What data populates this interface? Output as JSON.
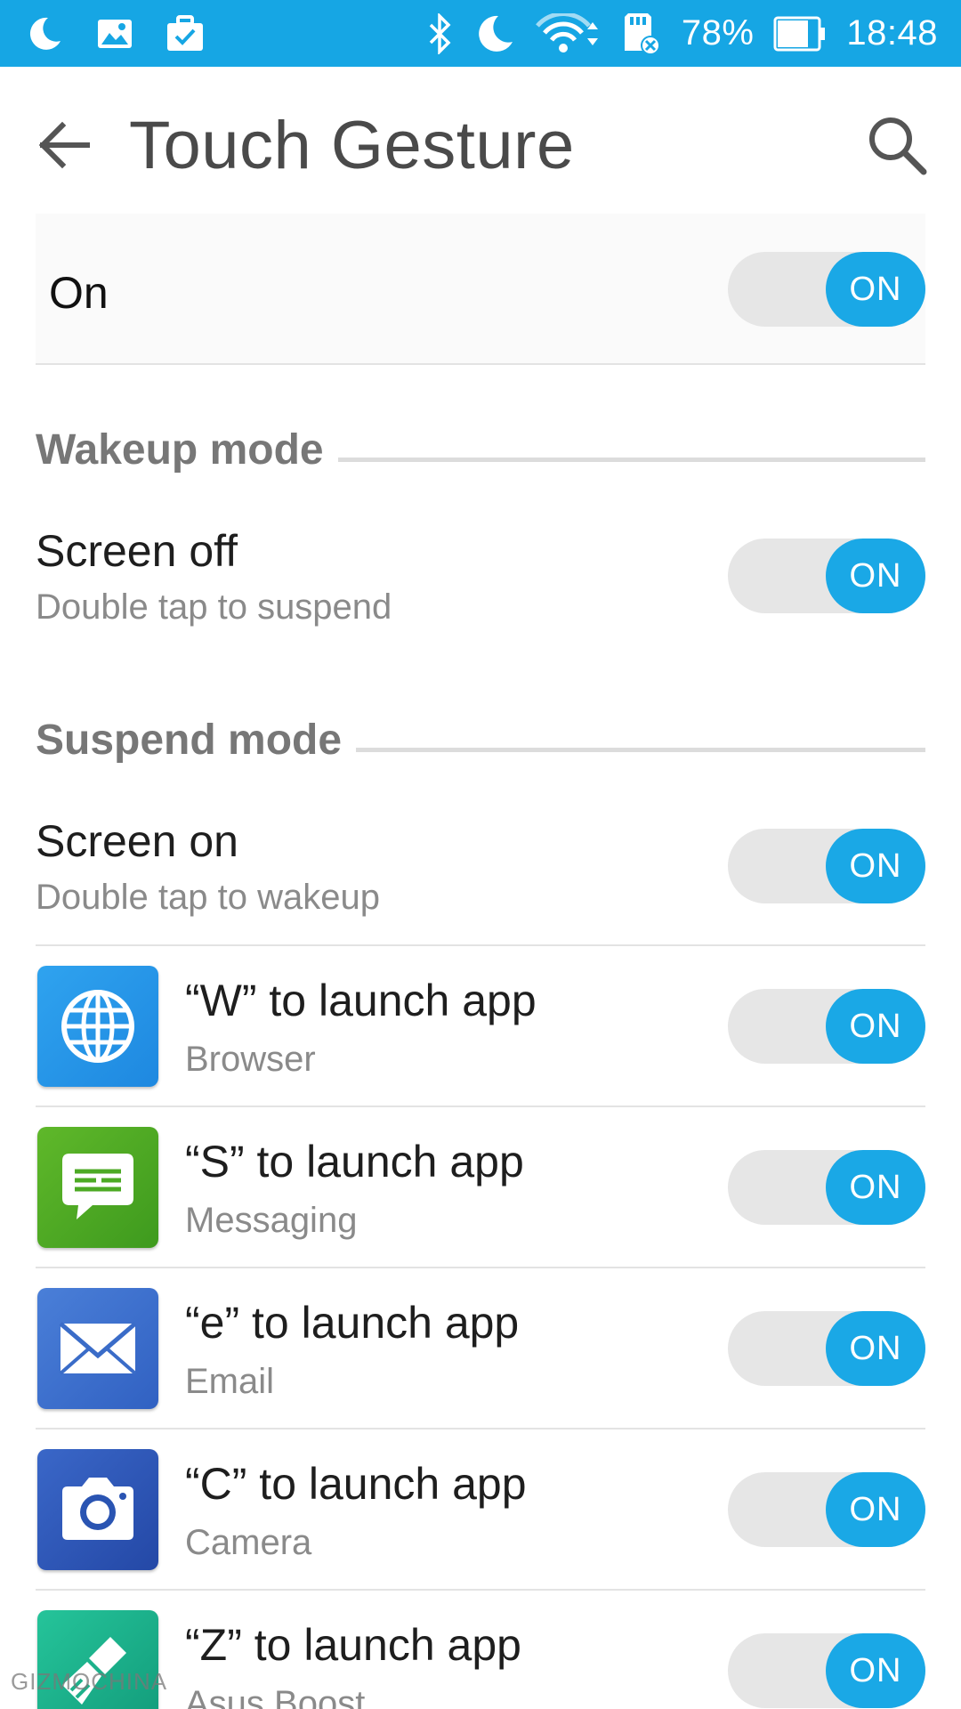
{
  "status_bar": {
    "icons_left": [
      "moon-icon",
      "image-icon",
      "briefcase-check-icon"
    ],
    "icons_right": [
      "bluetooth-icon",
      "moon-icon",
      "wifi-icon",
      "sdcard-icon"
    ],
    "battery_percent": "78%",
    "battery_level": 0.78,
    "time": "18:48",
    "color": "#16a6e4"
  },
  "app_bar": {
    "title": "Touch Gesture",
    "back_icon": "arrow-left-icon",
    "search_icon": "search-icon"
  },
  "master_switch": {
    "label": "On",
    "toggle": "ON",
    "enabled": true
  },
  "sections": [
    {
      "header": "Wakeup mode",
      "items": [
        {
          "title": "Screen off",
          "subtitle": "Double tap to suspend",
          "toggle": "ON",
          "enabled": true
        }
      ]
    },
    {
      "header": "Suspend mode",
      "items": [
        {
          "title": "Screen on",
          "subtitle": "Double tap to wakeup",
          "toggle": "ON",
          "enabled": true
        },
        {
          "title": "“W” to launch app",
          "subtitle": "Browser",
          "icon": "globe-icon",
          "toggle": "ON",
          "enabled": true
        },
        {
          "title": "“S” to launch app",
          "subtitle": "Messaging",
          "icon": "chat-bubble-icon",
          "toggle": "ON",
          "enabled": true
        },
        {
          "title": "“e” to launch app",
          "subtitle": "Email",
          "icon": "envelope-icon",
          "toggle": "ON",
          "enabled": true
        },
        {
          "title": "“C” to launch app",
          "subtitle": "Camera",
          "icon": "camera-icon",
          "toggle": "ON",
          "enabled": true
        },
        {
          "title": "“Z” to launch app",
          "subtitle": "Asus Boost",
          "icon": "broom-icon",
          "toggle": "ON",
          "enabled": true
        }
      ]
    }
  ],
  "watermark": "GIZMOCHINA",
  "colors": {
    "accent": "#1aa8e6",
    "toggle_track": "#e6e6e6",
    "section_header": "#777777",
    "subtitle": "#8a8a8a"
  }
}
